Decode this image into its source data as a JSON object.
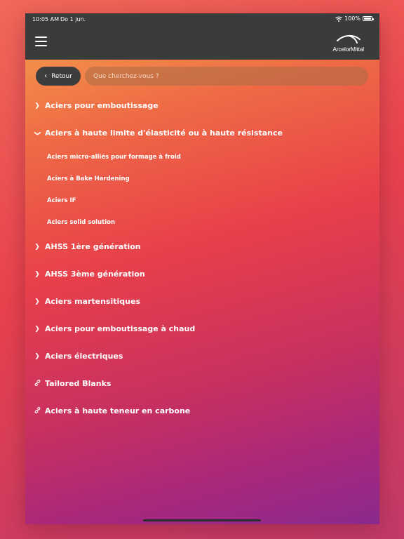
{
  "status": {
    "time": "10:05 AM",
    "date": "Do 1 jun.",
    "battery": "100%"
  },
  "header": {
    "logo_text": "ArcelorMittal"
  },
  "search": {
    "back_label": "Retour",
    "placeholder": "Que cherchez-vous ?"
  },
  "menu": {
    "items": [
      {
        "label": "Aciers pour emboutissage",
        "icon": "chevron-right-icon"
      },
      {
        "label": "Aciers à haute limite d'élasticité ou à haute résistance",
        "icon": "chevron-down-icon"
      },
      {
        "label": "AHSS 1ère génération",
        "icon": "chevron-right-icon"
      },
      {
        "label": "AHSS 3ème génération",
        "icon": "chevron-right-icon"
      },
      {
        "label": "Aciers martensitiques",
        "icon": "chevron-right-icon"
      },
      {
        "label": "Aciers pour emboutissage à chaud",
        "icon": "chevron-right-icon"
      },
      {
        "label": "Aciers électriques",
        "icon": "chevron-right-icon"
      },
      {
        "label": "Tailored Blanks",
        "icon": "link-icon"
      },
      {
        "label": "Aciers à haute teneur en carbone",
        "icon": "link-icon"
      }
    ],
    "subitems": [
      {
        "label": "Aciers micro-alliés pour formage à froid"
      },
      {
        "label": "Aciers à Bake Hardening"
      },
      {
        "label": "Aciers IF"
      },
      {
        "label": "Aciers solid solution"
      }
    ]
  }
}
